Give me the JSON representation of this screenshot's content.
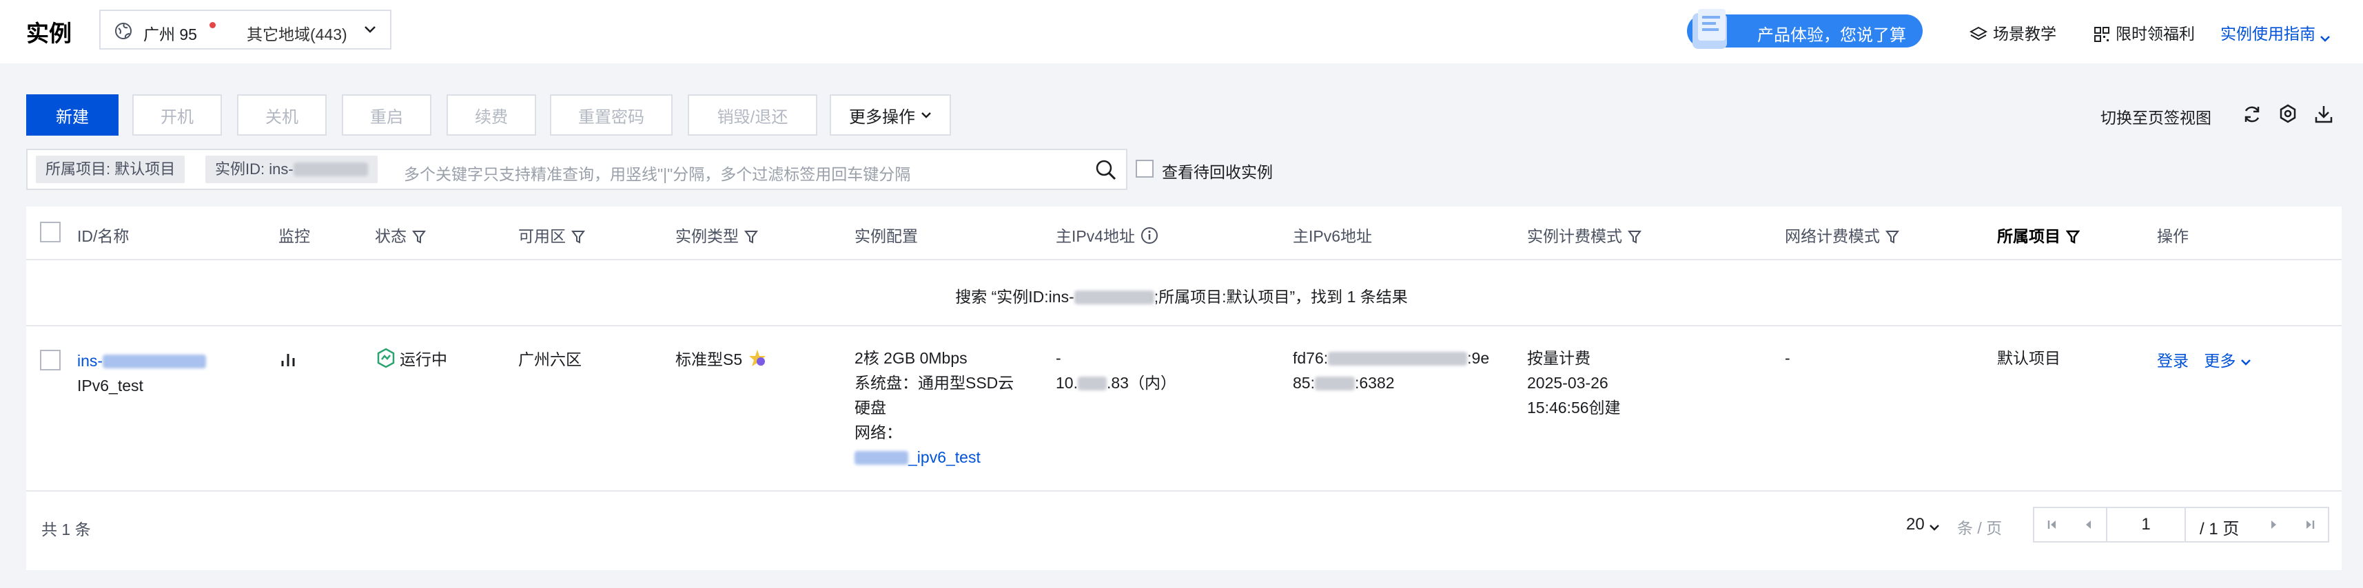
{
  "header": {
    "title": "实例",
    "region": {
      "name": "广州 95",
      "other": "其它地域(443)"
    },
    "banner": "产品体验，您说了算",
    "links": {
      "scene": "场景教学",
      "welfare": "限时领福利",
      "guide": "实例使用指南"
    }
  },
  "toolbar": {
    "new": "新建",
    "start": "开机",
    "shutdown": "关机",
    "restart": "重启",
    "renew": "续费",
    "reset_password": "重置密码",
    "destroy": "销毁/退还",
    "more": "更多操作",
    "tab_view": "切换至页签视图"
  },
  "search": {
    "tag_project": "所属项目: 默认项目",
    "tag_instance": "实例ID: ins-",
    "placeholder": "多个关键字只支持精准查询，用竖线\"|\"分隔，多个过滤标签用回车键分隔",
    "recycle_label": "查看待回收实例"
  },
  "table": {
    "headers": {
      "id": "ID/名称",
      "monitor": "监控",
      "status": "状态",
      "zone": "可用区",
      "type": "实例类型",
      "config": "实例配置",
      "ipv4": "主IPv4地址",
      "ipv6": "主IPv6地址",
      "billing": "实例计费模式",
      "net_billing": "网络计费模式",
      "project": "所属项目",
      "ops": "操作"
    },
    "result_pre": "搜索 “实例ID:ins-",
    "result_post": ";所属项目:默认项目”，找到 1 条结果",
    "row": {
      "id_prefix": "ins-",
      "name": "IPv6_test",
      "status": "运行中",
      "zone": "广州六区",
      "type": "标准型S5",
      "config_line1": "2核 2GB 0Mbps",
      "config_line2": "系统盘：通用型SSD云",
      "config_line3": "硬盘",
      "config_line4": "网络：",
      "network_suffix": "_ipv6_test",
      "ipv4_line1": "-",
      "ipv4_pre": "10.",
      "ipv4_post": ".83（内）",
      "ipv6_pre": "fd76:",
      "ipv6_mid": ":9e",
      "ipv6_line2_pre": "85:",
      "ipv6_line2_post": ":6382",
      "billing_line1": "按量计费",
      "billing_line2": "2025-03-26",
      "billing_line3": "15:46:56创建",
      "net_billing": "-",
      "project": "默认项目",
      "op_login": "登录",
      "op_more": "更多"
    }
  },
  "footer": {
    "total": "共 1 条",
    "page_size": "20",
    "page_size_unit": "条 / 页",
    "current_page": "1",
    "total_pages": "/ 1 页"
  },
  "colors": {
    "primary": "#0052d9",
    "banner": "#2e83f2",
    "running": "#2ba471",
    "alert_dot": "#e54545"
  }
}
